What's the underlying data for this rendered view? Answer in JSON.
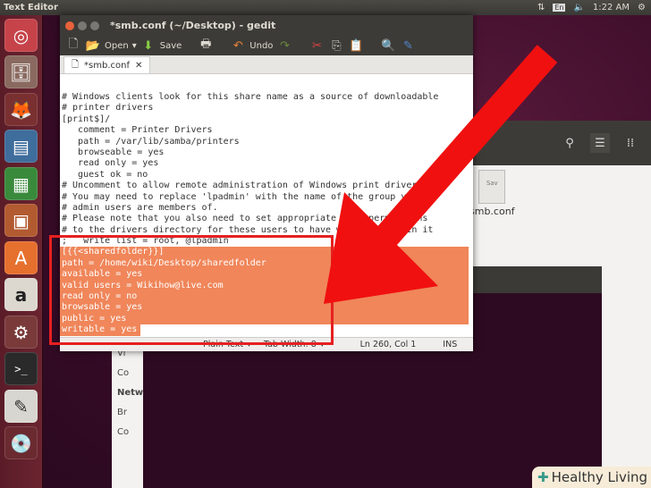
{
  "top_panel": {
    "app_title": "Text Editor",
    "keyboard": "En",
    "time": "1:22 AM"
  },
  "launcher": [
    "ubuntu-dash",
    "files",
    "firefox",
    "writer",
    "calc",
    "impress",
    "software-center",
    "amazon",
    "system-settings",
    "terminal",
    "text-editor",
    "dvd"
  ],
  "gedit": {
    "title": "*smb.conf (~/Desktop) - gedit",
    "toolbar": {
      "open": "Open",
      "save": "Save",
      "undo": "Undo"
    },
    "tab": "*smb.conf",
    "lines": [
      "# Windows clients look for this share name as a source of downloadable",
      "# printer drivers",
      "[print$]/",
      "   comment = Printer Drivers",
      "   path = /var/lib/samba/printers",
      "   browseable = yes",
      "   read only = yes",
      "   guest ok = no",
      "# Uncomment to allow remote administration of Windows print drivers.",
      "# You may need to replace 'lpadmin' with the name of the group your",
      "# admin users are members of.",
      "# Please note that you also need to set appropriate Unix permissions",
      "# to the drivers directory for these users to have write rights in it",
      ";   write list = root, @lpadmin"
    ],
    "selected_lines": [
      "[{{<sharedfolder}}]",
      "path = /home/wiki/Desktop/sharedfolder",
      "available = yes",
      "valid users = Wikihow@live.com",
      "read only = no",
      "browsable = yes",
      "public = yes",
      "writable = yes"
    ],
    "status": {
      "syntax": "Plain Text",
      "tab_width": "Tab Width: 8",
      "position": "Ln 260, Col 1",
      "mode": "INS"
    }
  },
  "files_window": {
    "file_label": "smb.conf",
    "file_icon_text": "Sav",
    "sidebar": [
      "Vi",
      "Co",
      "Network",
      "Br",
      "Co"
    ]
  },
  "watermark": {
    "brand": "Healthy Living"
  },
  "colors": {
    "selection": "#f0865a",
    "annotation": "#e62020"
  }
}
